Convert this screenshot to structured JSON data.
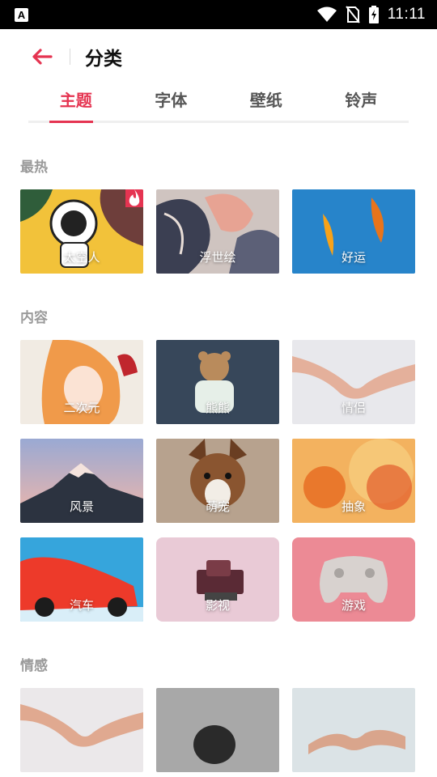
{
  "status_bar": {
    "time": "11:11",
    "icons": [
      "a-notification-icon",
      "wifi-icon",
      "no-sim-icon",
      "battery-charging-icon"
    ]
  },
  "header": {
    "title": "分类",
    "back_icon": "arrow-left-icon"
  },
  "tabs": [
    {
      "label": "主题",
      "active": true
    },
    {
      "label": "字体",
      "active": false
    },
    {
      "label": "壁纸",
      "active": false
    },
    {
      "label": "铃声",
      "active": false
    }
  ],
  "colors": {
    "accent": "#e53451"
  },
  "sections": [
    {
      "title": "最热",
      "tiles": [
        {
          "label": "太空人",
          "hot": true
        },
        {
          "label": "浮世绘"
        },
        {
          "label": "好运"
        }
      ]
    },
    {
      "title": "内容",
      "tiles": [
        {
          "label": "二次元"
        },
        {
          "label": "熊熊"
        },
        {
          "label": "情侣"
        },
        {
          "label": "风景"
        },
        {
          "label": "萌宠"
        },
        {
          "label": "抽象"
        },
        {
          "label": "汽车"
        },
        {
          "label": "影视"
        },
        {
          "label": "游戏"
        }
      ]
    },
    {
      "title": "情感",
      "tiles": [
        {
          "label": ""
        },
        {
          "label": ""
        },
        {
          "label": ""
        }
      ]
    }
  ]
}
